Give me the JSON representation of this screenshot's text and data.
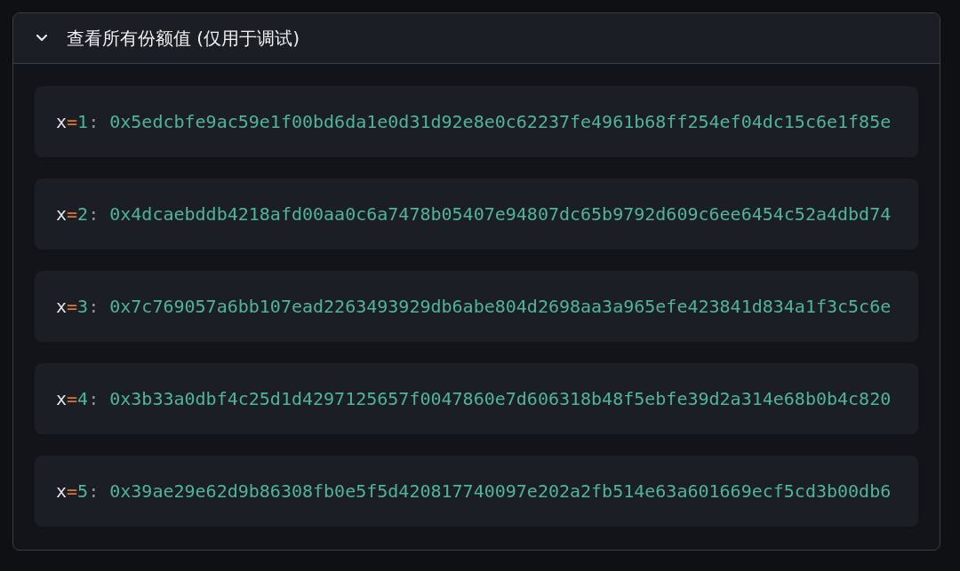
{
  "panel": {
    "title": "查看所有份额值 (仅用于调试)",
    "expanded": true,
    "shares": [
      {
        "tokens": [
          {
            "kind": "var",
            "text": "x"
          },
          {
            "kind": "op",
            "text": "="
          },
          {
            "kind": "num",
            "text": "1"
          },
          {
            "kind": "punct",
            "text": ":"
          },
          {
            "kind": "value",
            "text": "0x5edcbfe9ac59e1f00bd6da1e0d31d92e8e0c62237fe4961b68ff254ef04dc15c6e1f85e"
          }
        ]
      },
      {
        "tokens": [
          {
            "kind": "var",
            "text": "x"
          },
          {
            "kind": "op",
            "text": "="
          },
          {
            "kind": "num",
            "text": "2"
          },
          {
            "kind": "punct",
            "text": ":"
          },
          {
            "kind": "value",
            "text": "0x4dcaebddb4218afd00aa0c6a7478b05407e94807dc65b9792d609c6ee6454c52a4dbd74"
          }
        ]
      },
      {
        "tokens": [
          {
            "kind": "var",
            "text": "x"
          },
          {
            "kind": "op",
            "text": "="
          },
          {
            "kind": "num",
            "text": "3"
          },
          {
            "kind": "punct",
            "text": ":"
          },
          {
            "kind": "value",
            "text": "0x7c769057a6bb107ead2263493929db6abe804d2698aa3a965efe423841d834a1f3c5c6e"
          }
        ]
      },
      {
        "tokens": [
          {
            "kind": "var",
            "text": "x"
          },
          {
            "kind": "op",
            "text": "="
          },
          {
            "kind": "num",
            "text": "4"
          },
          {
            "kind": "punct",
            "text": ":"
          },
          {
            "kind": "value",
            "text": "0x3b33a0dbf4c25d1d4297125657f0047860e7d606318b48f5ebfe39d2a314e68b0b4c820"
          }
        ]
      },
      {
        "tokens": [
          {
            "kind": "var",
            "text": "x"
          },
          {
            "kind": "op",
            "text": "="
          },
          {
            "kind": "num",
            "text": "5"
          },
          {
            "kind": "punct",
            "text": ":"
          },
          {
            "kind": "value",
            "text": "0x39ae29e62d9b86308fb0e5f5d420817740097e202a2fb514e63a601669ecf5cd3b00db6"
          }
        ]
      }
    ]
  }
}
